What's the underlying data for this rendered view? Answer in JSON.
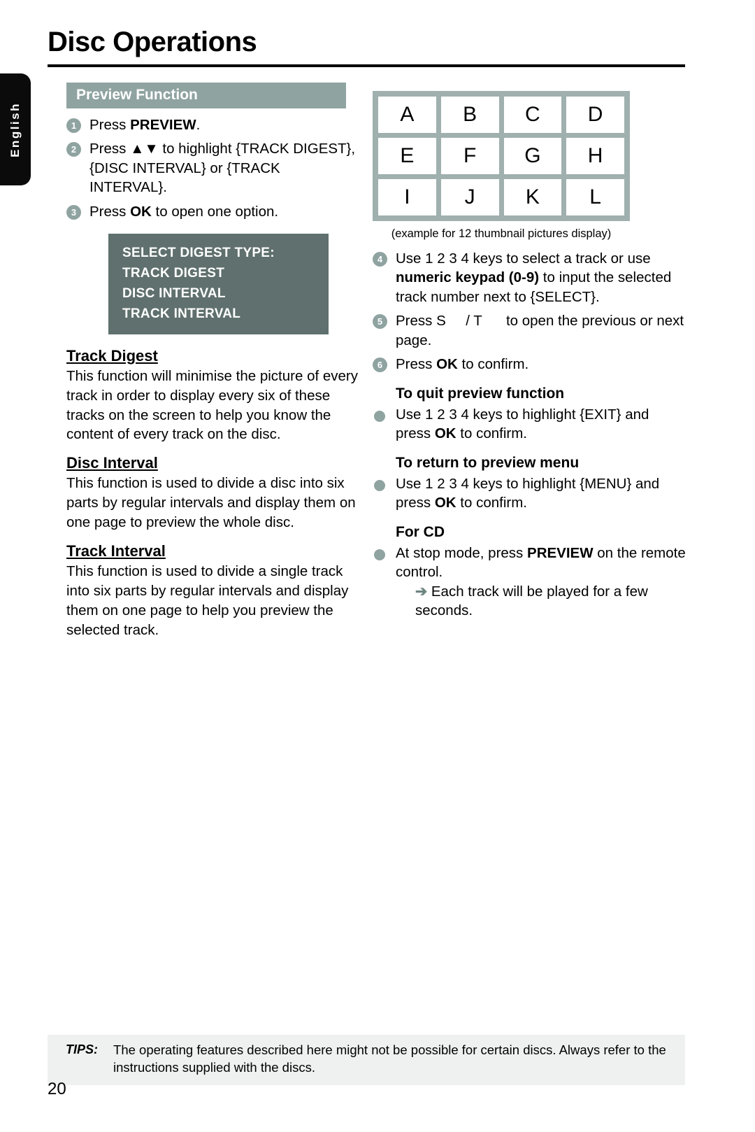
{
  "page": {
    "title": "Disc Operations",
    "number": "20",
    "language_tab": "English"
  },
  "section": {
    "banner": "Preview Function"
  },
  "left_column": {
    "steps": [
      {
        "num": "1",
        "html": "Press <b>PREVIEW</b>."
      },
      {
        "num": "2",
        "html": "Press ▲▼  to highlight {TRACK DIGEST}, {DISC INTERVAL} or {TRACK INTERVAL}."
      },
      {
        "num": "3",
        "html": "Press <b>OK</b> to open one option."
      }
    ],
    "osd_box": {
      "lines": [
        "SELECT DIGEST TYPE:",
        "TRACK DIGEST",
        "DISC INTERVAL",
        "TRACK INTERVAL"
      ]
    },
    "subsections": [
      {
        "heading": "Track Digest",
        "body": "This function will minimise the picture of every track in order to display every six of these tracks on the screen to help you know the content of every track on the disc."
      },
      {
        "heading": "Disc Interval",
        "body": "This function is used to divide a disc into six parts by regular intervals and display them on one page to preview the whole disc."
      },
      {
        "heading": "Track Interval",
        "body": "This function is used to divide a single track into six parts by regular intervals and display them on one page to help you preview the selected track."
      }
    ]
  },
  "right_column": {
    "thumbnail_grid": {
      "cells": [
        "A",
        "B",
        "C",
        "D",
        "E",
        "F",
        "G",
        "H",
        "I",
        "J",
        "K",
        "L"
      ],
      "caption": "(example for 12 thumbnail pictures display)"
    },
    "steps": [
      {
        "num": "4",
        "html": "Use 1 2 3 4  keys to select a track or use <b>numeric keypad (0-9)</b> to input the selected track number next to {SELECT}."
      },
      {
        "num": "5",
        "html": "Press S&nbsp;&nbsp;&nbsp;&nbsp; / T&nbsp;&nbsp;&nbsp;&nbsp;&nbsp; to open the previous or next page."
      },
      {
        "num": "6",
        "html": "Press <b>OK</b> to confirm."
      }
    ],
    "blocks": [
      {
        "heading": "To quit preview function",
        "bullet_html": "Use 1 2 3 4  keys to highlight {EXIT} and press <b>OK</b> to confirm."
      },
      {
        "heading": "To return to preview menu",
        "bullet_html": "Use 1 2 3 4  keys to highlight {MENU} and press <b>OK</b> to confirm."
      },
      {
        "heading": "For CD",
        "bullet_html": "At stop mode, press <b>PREVIEW</b> on the remote control.",
        "note_html": "<span class=\"arrow-glyph\">➔</span> Each track will be played for a few seconds."
      }
    ]
  },
  "tips": {
    "label": "TIPS:",
    "body": "The operating features described here might not be possible for certain discs.  Always refer to the instructions supplied with the discs."
  },
  "colors": {
    "accent_gray_green": "#8fa3a1",
    "osd_background": "#5f706e",
    "grid_background": "#9fb0ae",
    "tips_background": "#eef1f0"
  }
}
